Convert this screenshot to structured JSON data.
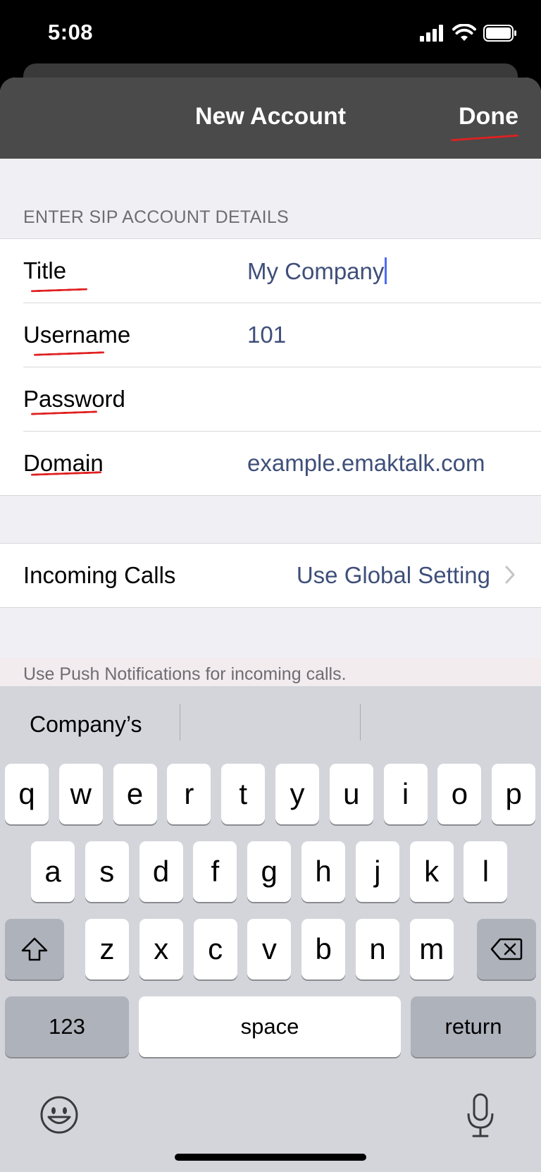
{
  "status_bar": {
    "time": "5:08"
  },
  "nav": {
    "title": "New Account",
    "done_label": "Done"
  },
  "form": {
    "section_header": "ENTER SIP ACCOUNT DETAILS",
    "fields": [
      {
        "label": "Title",
        "value": "My Company"
      },
      {
        "label": "Username",
        "value": "101"
      },
      {
        "label": "Password",
        "value": ""
      },
      {
        "label": "Domain",
        "value": "example.emaktalk.com"
      }
    ]
  },
  "incoming_calls": {
    "label": "Incoming Calls",
    "value": "Use Global Setting"
  },
  "hint": "Use Push Notifications for incoming calls.",
  "keyboard": {
    "suggestions": [
      "Company’s",
      "",
      ""
    ],
    "row1": [
      "q",
      "w",
      "e",
      "r",
      "t",
      "y",
      "u",
      "i",
      "o",
      "p"
    ],
    "row2": [
      "a",
      "s",
      "d",
      "f",
      "g",
      "h",
      "j",
      "k",
      "l"
    ],
    "row3": [
      "z",
      "x",
      "c",
      "v",
      "b",
      "n",
      "m"
    ],
    "numbers_label": "123",
    "space_label": "space",
    "return_label": "return"
  },
  "colors": {
    "accent_value": "#3f4f7a",
    "annotation": "#e02020",
    "caret": "#4b6cf5"
  }
}
